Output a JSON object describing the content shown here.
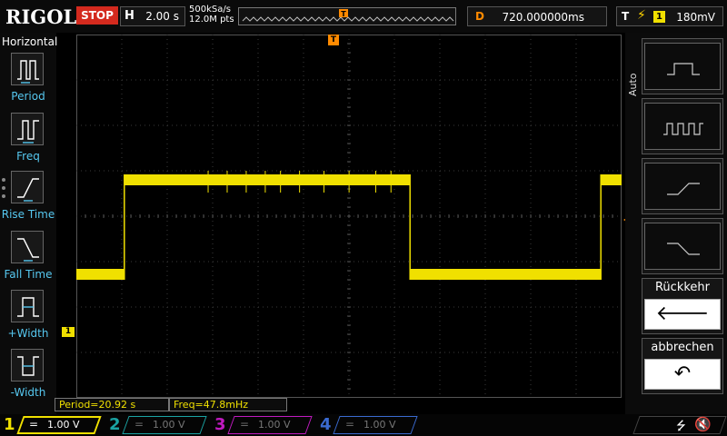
{
  "header": {
    "logo": "RIGOL",
    "run_state": "STOP",
    "horizontal_label": "H",
    "timebase": "2.00 s",
    "sample_rate": "500kSa/s",
    "memory_depth": "12.0M pts",
    "trigger_pos_label": "T",
    "delay_label": "D",
    "delay_value": "720.000000ms",
    "trigger_label": "T",
    "trigger_source": "1",
    "trigger_level": "180mV",
    "colors": {
      "run_state_bg": "#d42a1e",
      "ch1": "#f0e000",
      "trigger": "#ff8a00"
    }
  },
  "left_menu": {
    "title": "Horizontal",
    "items": [
      {
        "label": "Period",
        "icon": "period-icon"
      },
      {
        "label": "Freq",
        "icon": "frequency-icon"
      },
      {
        "label": "Rise Time",
        "icon": "rise-time-icon"
      },
      {
        "label": "Fall Time",
        "icon": "fall-time-icon"
      },
      {
        "label": "+Width",
        "icon": "positive-width-icon"
      },
      {
        "label": "-Width",
        "icon": "negative-width-icon"
      }
    ]
  },
  "waveform": {
    "channel_marker": "1",
    "trigger_marker": "T",
    "ch1_high_spans": [
      [
        0.088,
        0.612
      ],
      [
        0.962,
        1.0
      ]
    ],
    "ch1_high_level": 0.8,
    "ch1_low_level": -1.28
  },
  "measurements": {
    "period": "Period=20.92 s",
    "freq": "Freq=47.8mHz"
  },
  "right_menu": {
    "side_label": "Auto",
    "keys": [
      {
        "icon": "single-pulse-icon"
      },
      {
        "icon": "pulse-train-icon"
      },
      {
        "icon": "rising-edge-icon"
      },
      {
        "icon": "falling-edge-icon"
      }
    ],
    "back_label": "Rückkehr",
    "back_icon": "back-arrow-icon",
    "cancel_label": "abbrechen",
    "cancel_icon": "undo-icon"
  },
  "channels": [
    {
      "num": "1",
      "coupling": "=",
      "scale": "1.00 V",
      "color": "#f0e000",
      "active": true
    },
    {
      "num": "2",
      "coupling": "=",
      "scale": "1.00 V",
      "color": "#1aa3a3",
      "active": false
    },
    {
      "num": "3",
      "coupling": "=",
      "scale": "1.00 V",
      "color": "#c01ac0",
      "active": false
    },
    {
      "num": "4",
      "coupling": "=",
      "scale": "1.00 V",
      "color": "#3a6ad0",
      "active": false
    }
  ],
  "status": {
    "usb_icon": "usb-icon",
    "sound_icon": "speaker-muted-icon"
  }
}
